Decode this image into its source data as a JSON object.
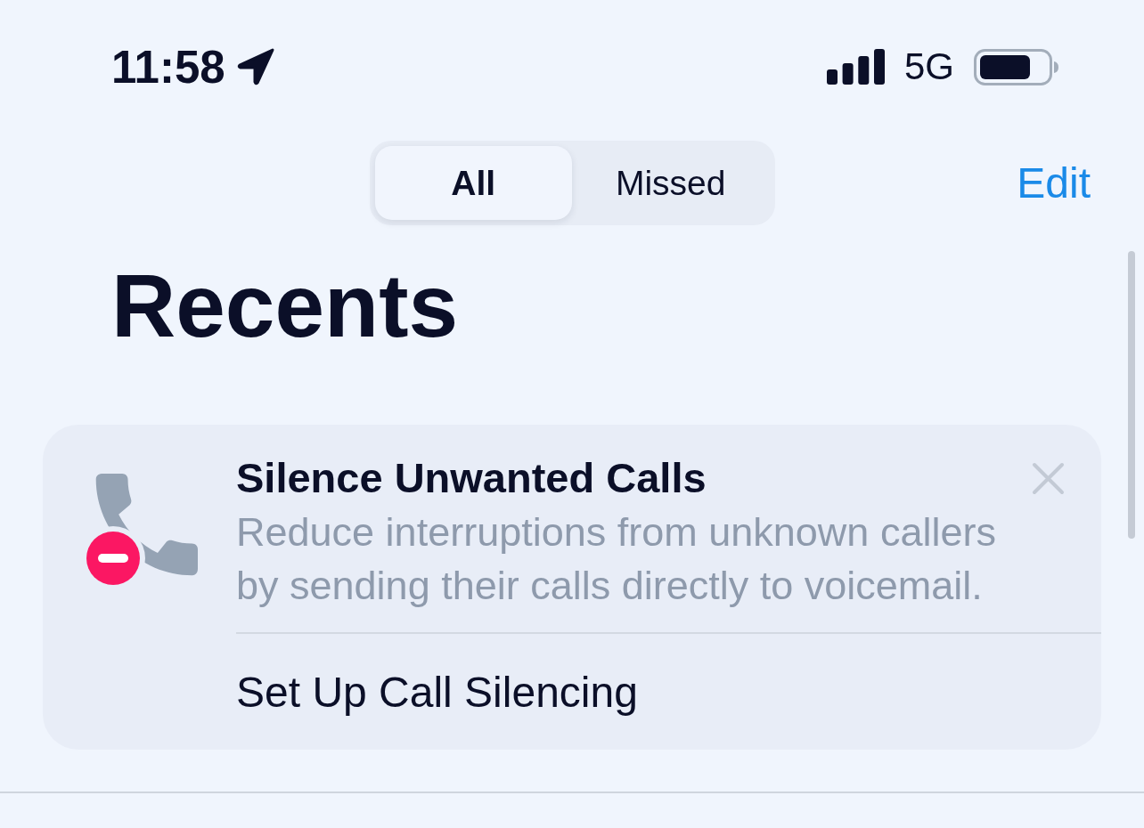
{
  "status_bar": {
    "time": "11:58",
    "network": "5G"
  },
  "segments": [
    {
      "label": "All",
      "selected": true
    },
    {
      "label": "Missed",
      "selected": false
    }
  ],
  "edit_button": "Edit",
  "title": "Recents",
  "banner": {
    "title": "Silence Unwanted Calls",
    "description": "Reduce interruptions from unknown callers by sending their calls directly to voicemail.",
    "action": "Set Up Call Silencing"
  }
}
